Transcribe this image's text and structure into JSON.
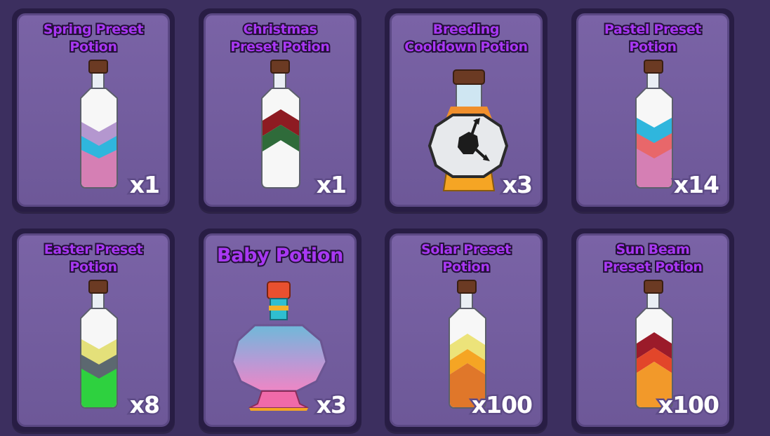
{
  "inventory": {
    "items": [
      {
        "name_lines": [
          "Spring Preset",
          "Potion"
        ],
        "count": "x1"
      },
      {
        "name_lines": [
          "Christmas",
          "Preset Potion"
        ],
        "count": "x1"
      },
      {
        "name_lines": [
          "Breeding",
          "Cooldown Potion"
        ],
        "count": "x3"
      },
      {
        "name_lines": [
          "Pastel Preset",
          "Potion"
        ],
        "count": "x14"
      },
      {
        "name_lines": [
          "Easter Preset",
          "Potion"
        ],
        "count": "x8"
      },
      {
        "name_lines": [
          "Baby Potion"
        ],
        "count": "x3"
      },
      {
        "name_lines": [
          "Solar Preset",
          "Potion"
        ],
        "count": "x100"
      },
      {
        "name_lines": [
          "Sun Beam",
          "Preset Potion"
        ],
        "count": "x100"
      }
    ]
  },
  "icons": {
    "card0": "spring-preset-potion-icon",
    "card1": "christmas-preset-potion-icon",
    "card2": "breeding-cooldown-potion-icon",
    "card3": "pastel-preset-potion-icon",
    "card4": "easter-preset-potion-icon",
    "card5": "baby-potion-icon",
    "card6": "solar-preset-potion-icon",
    "card7": "sun-beam-preset-potion-icon"
  },
  "colors": {
    "background": "#3c2f5f",
    "card_fill": "#7a63a6",
    "title_text": "#a838f2",
    "count_text": "#ffffff"
  }
}
